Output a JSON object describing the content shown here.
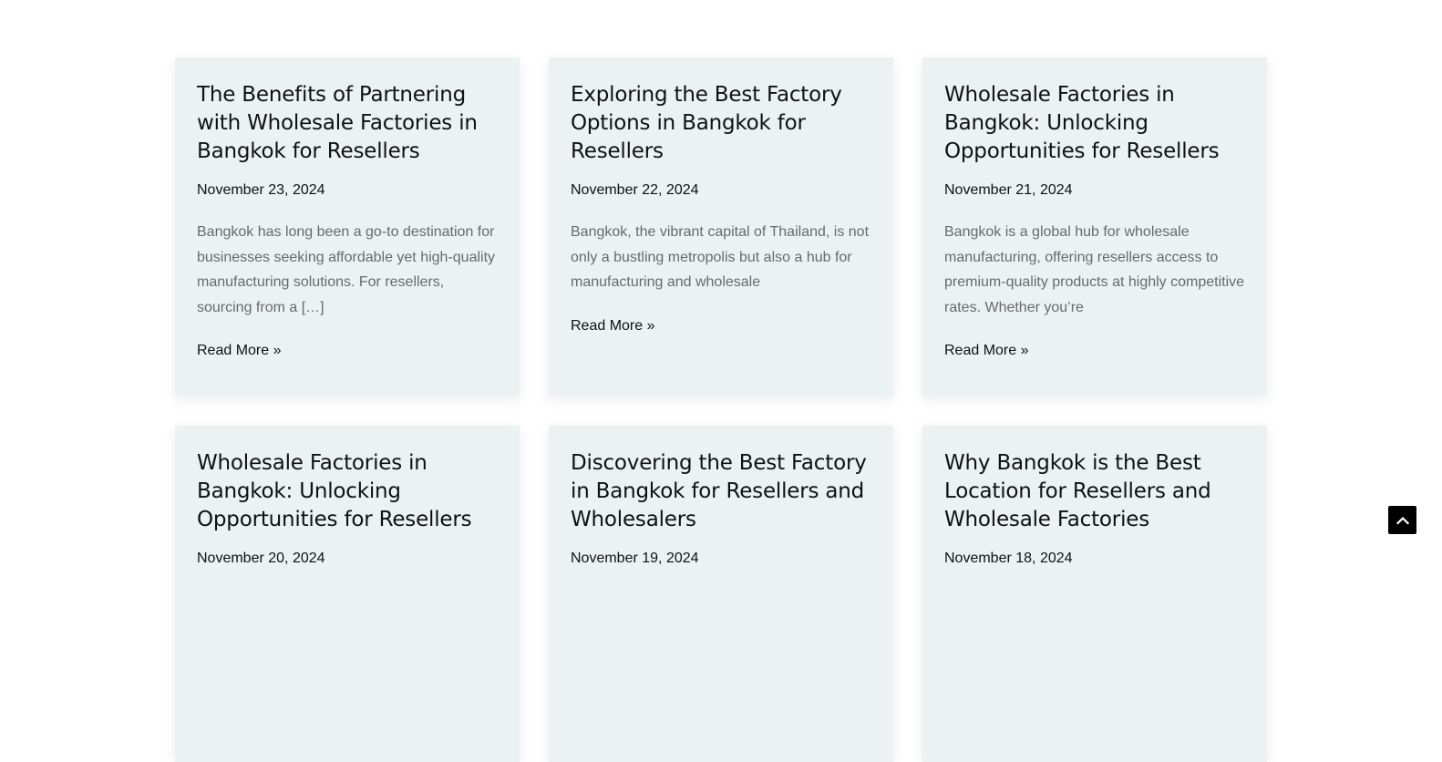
{
  "posts": [
    {
      "title": "The Benefits of Partnering with Wholesale Factories in Bangkok for Resellers",
      "date": "November 23, 2024",
      "excerpt": "Bangkok has long been a go-to destination for businesses seeking affordable yet high-quality manufacturing solutions. For resellers, sourcing from a […]",
      "read_more": "Read More »"
    },
    {
      "title": "Exploring the Best Factory Options in Bangkok for Resellers",
      "date": "November 22, 2024",
      "excerpt": "Bangkok, the vibrant capital of Thailand, is not only a bustling metropolis but also a hub for manufacturing and wholesale",
      "read_more": "Read More »"
    },
    {
      "title": "Wholesale Factories in Bangkok: Unlocking Opportunities for Resellers",
      "date": "November 21, 2024",
      "excerpt": "Bangkok is a global hub for wholesale manufacturing, offering resellers access to premium-quality products at highly competitive rates. Whether you’re",
      "read_more": "Read More »"
    },
    {
      "title": "Wholesale Factories in Bangkok: Unlocking Opportunities for Resellers",
      "date": "November 20, 2024"
    },
    {
      "title": "Discovering the Best Factory in Bangkok for Resellers and Wholesalers",
      "date": "November 19, 2024"
    },
    {
      "title": "Why Bangkok is the Best Location for Resellers and Wholesale Factories",
      "date": "November 18, 2024"
    }
  ],
  "back_to_top": {
    "icon": "chevron-up-icon"
  }
}
